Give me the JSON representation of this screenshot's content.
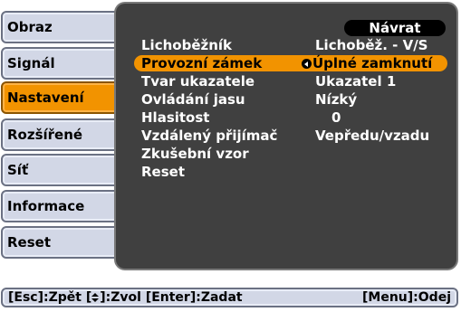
{
  "sidebar": {
    "items": [
      {
        "label": "Obraz"
      },
      {
        "label": "Signál"
      },
      {
        "label": "Nastavení"
      },
      {
        "label": "Rozšířené"
      },
      {
        "label": "Síť"
      },
      {
        "label": "Informace"
      },
      {
        "label": "Reset"
      }
    ],
    "active_index": 2
  },
  "panel": {
    "back_label": "Návrat",
    "rows": [
      {
        "label": "Lichoběžník",
        "value": "Lichoběž. - V/S"
      },
      {
        "label": "Provozní zámek",
        "value": "Úplné zamknutí",
        "selected": true
      },
      {
        "label": "Tvar ukazatele",
        "value": "Ukazatel 1"
      },
      {
        "label": "Ovládání jasu",
        "value": "Nízký"
      },
      {
        "label": "Hlasitost",
        "value": "0"
      },
      {
        "label": "Vzdálený přijímač",
        "value": "Vepředu/vzadu"
      },
      {
        "label": "Zkušební vzor",
        "value": ""
      },
      {
        "label": "Reset",
        "value": ""
      }
    ]
  },
  "hints": {
    "esc": "[Esc]:Zpět",
    "select_open": "[",
    "select_close": "]:Zvol",
    "enter": "[Enter]:Zadat",
    "menu": "[Menu]:Odej"
  },
  "colors": {
    "accent": "#f29300",
    "panel_bg": "#404040",
    "tab_bg": "#d2d7e6"
  },
  "icons": {
    "enter": "enter-icon",
    "updown": "updown-arrows-icon"
  }
}
